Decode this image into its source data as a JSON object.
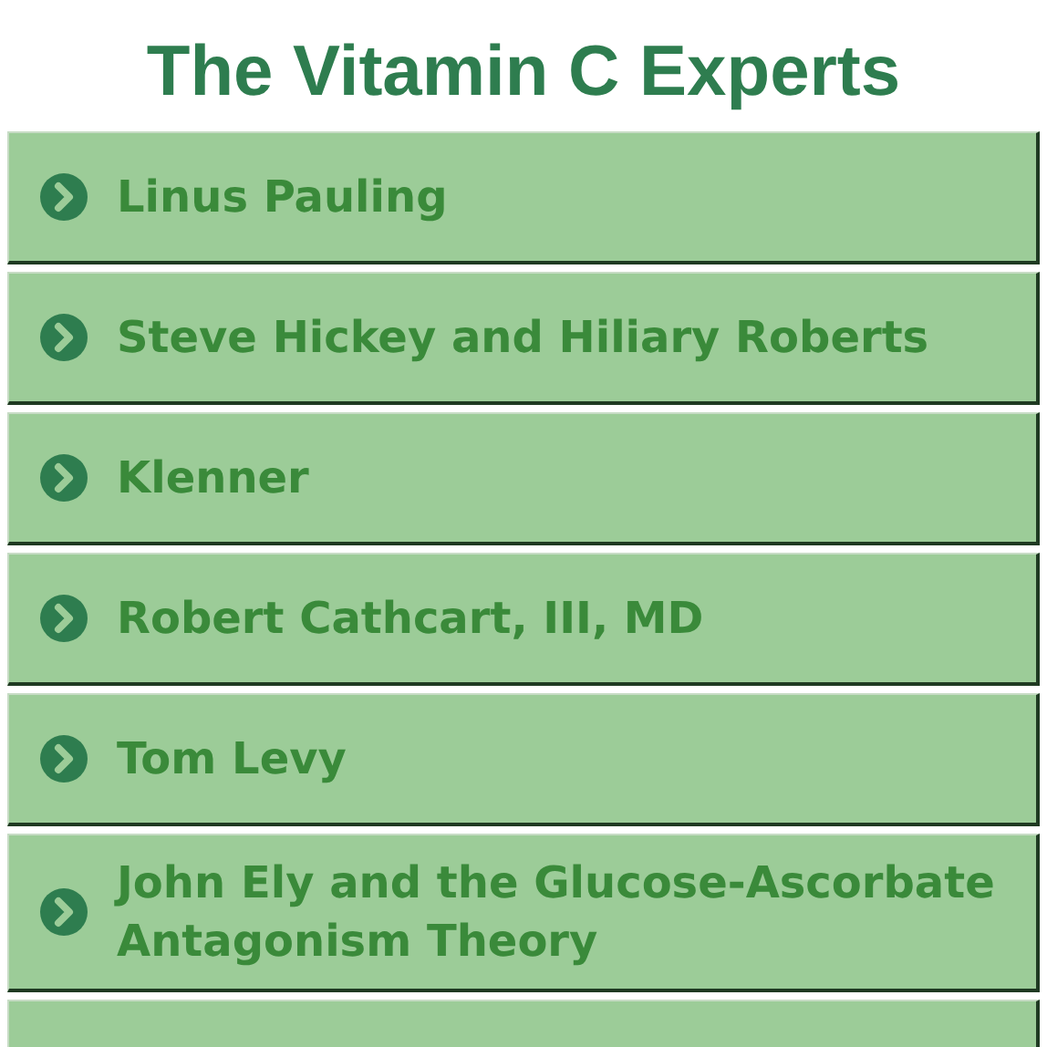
{
  "title": "The Vitamin C Experts",
  "items": [
    {
      "label": "Linus Pauling"
    },
    {
      "label": "Steve Hickey and Hiliary Roberts"
    },
    {
      "label": "Klenner"
    },
    {
      "label": "Robert Cathcart, III, MD"
    },
    {
      "label": "Tom Levy"
    },
    {
      "label": "John Ely and the Glucose-Ascorbate Antagonism Theory"
    }
  ]
}
